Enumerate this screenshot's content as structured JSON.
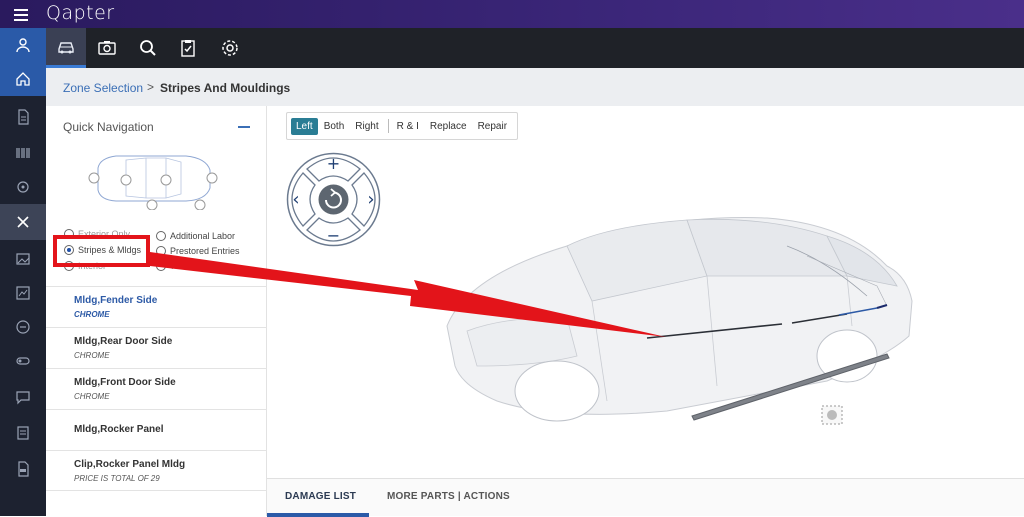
{
  "app": {
    "title": "Qapter"
  },
  "toolbar": {
    "tools": [
      "car-icon",
      "camera-icon",
      "search-icon",
      "clipboard-check-icon",
      "gear-icon"
    ]
  },
  "breadcrumb": {
    "parent": "Zone Selection",
    "separator": ">",
    "current": "Stripes And Mouldings"
  },
  "quick_nav": {
    "title": "Quick Navigation",
    "options": {
      "exterior": "Exterior Only",
      "stripes": "Stripes & Mldgs",
      "interior": "Interior",
      "additional_labor": "Additional Labor",
      "prestored": "Prestored Entries",
      "wheels": "Wheels"
    },
    "selected": "Stripes & Mldgs"
  },
  "parts": [
    {
      "name": "Mldg,Fender Side",
      "sub": "CHROME",
      "selected": true
    },
    {
      "name": "Mldg,Rear Door Side",
      "sub": "CHROME",
      "selected": false
    },
    {
      "name": "Mldg,Front Door Side",
      "sub": "CHROME",
      "selected": false
    },
    {
      "name": "Mldg,Rocker Panel",
      "sub": "",
      "selected": false
    },
    {
      "name": "Clip,Rocker Panel Mldg",
      "sub": "PRICE IS TOTAL OF 29",
      "selected": false
    }
  ],
  "side_selector": {
    "options": [
      "Left",
      "Both",
      "Right",
      "R & I",
      "Replace",
      "Repair"
    ],
    "active": "Left"
  },
  "dpad": {
    "zoom_in": "+",
    "zoom_out": "−",
    "left": "‹",
    "right": "›"
  },
  "bottom_tabs": {
    "damage_list": "DAMAGE LIST",
    "more_parts": "MORE PARTS | ACTIONS"
  },
  "colors": {
    "topbar": "#2a1a5e",
    "accent": "#2a7d94",
    "link": "#3b6fb6",
    "highlight": "#e3141a"
  }
}
